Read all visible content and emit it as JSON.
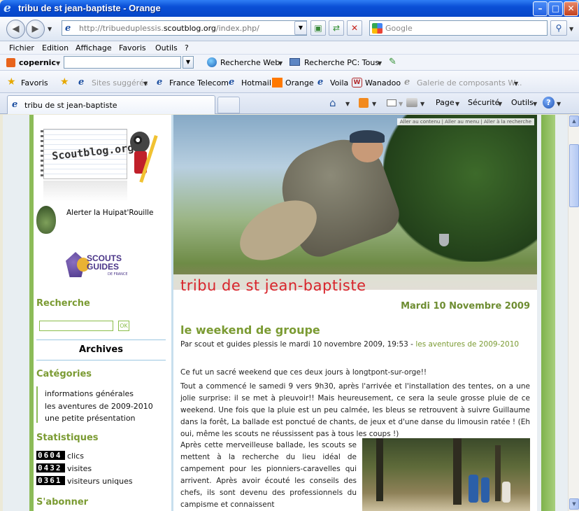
{
  "window": {
    "title": "tribu de st jean-baptiste - Orange",
    "minimize": "–",
    "maximize": "□",
    "close": "✕"
  },
  "nav": {
    "address": "http://tribueduplessis.scoutblog.org/index.php/",
    "address_domain": "scoutblog.org",
    "search_placeholder": "Google"
  },
  "menu": [
    "Fichier",
    "Edition",
    "Affichage",
    "Favoris",
    "Outils",
    "?"
  ],
  "copernic": {
    "brand": "copernic",
    "web_search": "Recherche Web",
    "pc_search": "Recherche PC: Tous"
  },
  "favorites": {
    "label": "Favoris",
    "items": [
      "Sites suggérés",
      "France Telecom",
      "Hotmail",
      "Orange",
      "Voila",
      "Wanadoo",
      "Galerie de composants W..."
    ]
  },
  "tab": {
    "title": "tribu de st jean-baptiste"
  },
  "commands": {
    "page": "Page",
    "security": "Sécurité",
    "tools": "Outils"
  },
  "page": {
    "access_links": "Aller au contenu | Aller au menu | Aller à la recherche",
    "blog_title": "tribu de st jean-baptiste",
    "date": "Mardi 10 Novembre 2009",
    "post_title": "le weekend de groupe",
    "post_meta": "Par scout et guides plessis le mardi 10 novembre 2009, 19:53 -",
    "post_category": "les aventures de 2009-2010",
    "p1": "Ce fut un sacré weekend que ces deux jours à longtpont-sur-orge!!",
    "p2": "Tout a commencé le samedi 9 vers 9h30, après l'arrivée et l'installation des tentes, on a une jolie surprise: il se met à pleuvoir!! Mais heureusement, ce sera la seule grosse pluie de ce weekend. Une fois que la pluie est un peu calmée, les bleus se retrouvent à suivre Guillaume dans la forêt, La ballade est ponctué de chants, de jeux et d'une danse du limousin ratée ! (Eh oui, même les scouts ne réussissent pas à tous les coups !)",
    "p3": "Après cette merveilleuse ballade, les scouts se mettent à la recherche du lieu idéal de campement pour les pionniers-caravelles qui arrivent. Après avoir écouté les conseils des chefs, ils sont devenu des professionnels du campisme et connaissent"
  },
  "sidebar": {
    "scoutblog_logo": "Scoutblog.org",
    "alert": "Alerter la Huipat'Rouille",
    "sgdf_logo": "SCOUTS GUIDES",
    "sgdf_sub": "DE FRANCE",
    "search_title": "Recherche",
    "search_ok": "OK",
    "archives": "Archives",
    "categories_title": "Catégories",
    "categories": [
      "informations générales",
      "les aventures de 2009-2010",
      "une petite présentation"
    ],
    "stats_title": "Statistiques",
    "stats": [
      {
        "count": "0604",
        "label": "clics"
      },
      {
        "count": "0432",
        "label": "visites"
      },
      {
        "count": "0361",
        "label": "visiteurs uniques"
      }
    ],
    "subscribe_title": "S'abonner"
  }
}
